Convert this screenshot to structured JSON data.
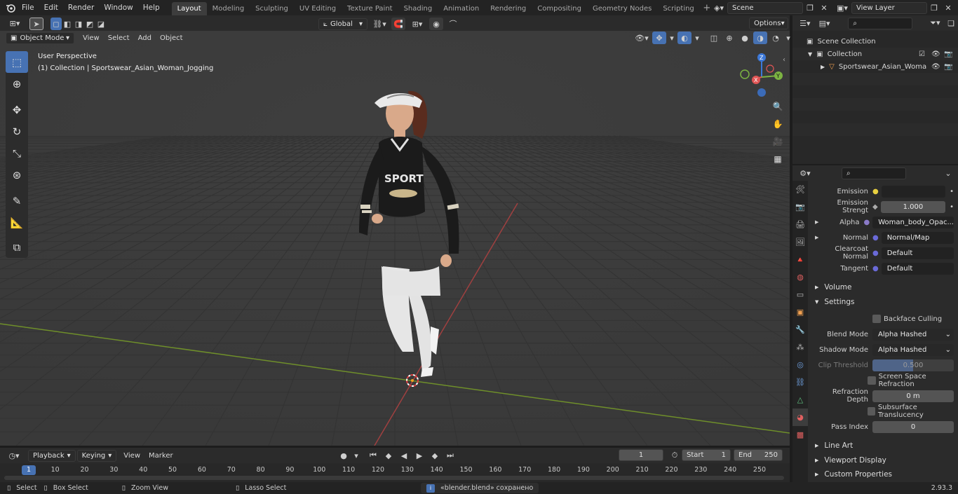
{
  "app": {
    "menus": [
      "File",
      "Edit",
      "Render",
      "Window",
      "Help"
    ],
    "workspaces": [
      "Layout",
      "Modeling",
      "Sculpting",
      "UV Editing",
      "Texture Paint",
      "Shading",
      "Animation",
      "Rendering",
      "Compositing",
      "Geometry Nodes",
      "Scripting"
    ],
    "active_workspace": "Layout",
    "scene": "Scene",
    "view_layer": "View Layer"
  },
  "viewport": {
    "mode": "Object Mode",
    "menus": [
      "View",
      "Select",
      "Add",
      "Object"
    ],
    "orientation": "Global",
    "options_label": "Options",
    "overlay_title": "User Perspective",
    "overlay_sub": "(1) Collection | Sportswear_Asian_Woman_Jogging",
    "gizmo_labels": {
      "x": "X",
      "y": "Y",
      "z": "Z"
    },
    "shirt_text": "SPORT"
  },
  "outliner": {
    "search_placeholder": "",
    "rows": [
      "Scene Collection",
      "Collection",
      "Sportswear_Asian_Woma"
    ]
  },
  "properties": {
    "fields": [
      {
        "label": "Emission",
        "value": ""
      },
      {
        "label": "Emission Strengt",
        "value": "1.000"
      },
      {
        "label": "Alpha",
        "value": "Woman_body_Opac..."
      },
      {
        "label": "Normal",
        "value": "Normal/Map"
      },
      {
        "label": "Clearcoat Normal",
        "value": "Default"
      },
      {
        "label": "Tangent",
        "value": "Default"
      }
    ],
    "sections": {
      "volume": "Volume",
      "settings": "Settings",
      "line_art": "Line Art",
      "viewport_display": "Viewport Display",
      "custom_properties": "Custom Properties"
    },
    "settings": {
      "backface": "Backface Culling",
      "blend_label": "Blend Mode",
      "blend_value": "Alpha Hashed",
      "shadow_label": "Shadow Mode",
      "shadow_value": "Alpha Hashed",
      "clip_label": "Clip Threshold",
      "clip_value": "0.500",
      "clip_fraction": 0.5,
      "ssr": "Screen Space Refraction",
      "refraction_label": "Refraction Depth",
      "refraction_value": "0 m",
      "subsurface": "Subsurface Translucency",
      "pass_label": "Pass Index",
      "pass_value": "0"
    }
  },
  "timeline": {
    "menus": [
      "Playback",
      "Keying",
      "View",
      "Marker"
    ],
    "current_frame": "1",
    "start_label": "Start",
    "start": "1",
    "end_label": "End",
    "end": "250",
    "ticks": [
      "1",
      "10",
      "20",
      "30",
      "40",
      "50",
      "60",
      "70",
      "80",
      "90",
      "100",
      "110",
      "120",
      "130",
      "140",
      "150",
      "160",
      "170",
      "180",
      "190",
      "200",
      "210",
      "220",
      "230",
      "240",
      "250"
    ]
  },
  "status": {
    "select": "Select",
    "box_select": "Box Select",
    "zoom_view": "Zoom View",
    "lasso": "Lasso Select",
    "message": "«blender.blend» сохранено",
    "version": "2.93.3"
  }
}
